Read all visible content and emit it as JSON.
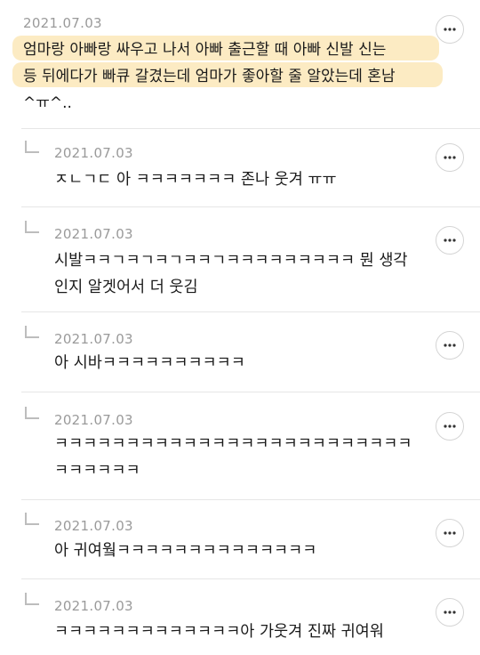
{
  "comments": [
    {
      "date": "2021.07.03",
      "text": "엄마랑 아빠랑 싸우고 나서 아빠 출근할 때 아빠 신발 신는\n등 뒤에다가 빠큐 갈겼는데 엄마가 좋아할 줄 알았는데 혼남\n^ㅠ^..",
      "more_icon": "more-horizontal-icon"
    },
    {
      "date": "2021.07.03",
      "text": "ㅈㄴㄱㄷ 아 ㅋㅋㅋㅋㅋㅋㅋ 존나 웃겨 ㅠㅠ",
      "reply_icon": "reply-arrow-icon",
      "more_icon": "more-horizontal-icon"
    },
    {
      "date": "2021.07.03",
      "text": "시발ㅋㅋㄱㅋㄱㅋㄱㅋㅋㄱㅋㅋㅋㅋㅋㅋㅋㅋㅋ 뭔 생각\n인지 알겟어서 더 웃김",
      "reply_icon": "reply-arrow-icon",
      "more_icon": "more-horizontal-icon"
    },
    {
      "date": "2021.07.03",
      "text": "아 시바ㅋㅋㅋㅋㅋㅋㅋㅋㅋㅋ",
      "reply_icon": "reply-arrow-icon",
      "more_icon": "more-horizontal-icon"
    },
    {
      "date": "2021.07.03",
      "text": "ㅋㅋㅋㅋㅋㅋㅋㅋㅋㅋㅋㅋㅋㅋㅋㅋㅋㅋㅋㅋㅋㅋㅋㅋㅋ\nㅋㅋㅋㅋㅋㅋ",
      "reply_icon": "reply-arrow-icon",
      "more_icon": "more-horizontal-icon"
    },
    {
      "date": "2021.07.03",
      "text": "아 귀여웤ㅋㅋㅋㅋㅋㅋㅋㅋㅋㅋㅋㅋㅋㅋ",
      "reply_icon": "reply-arrow-icon",
      "more_icon": "more-horizontal-icon"
    },
    {
      "date": "2021.07.03",
      "text": "ㅋㅋㅋㅋㅋㅋㅋㅋㅋㅋㅋㅋㅋ아 가웃겨 진짜 귀여워",
      "reply_icon": "reply-arrow-icon",
      "more_icon": "more-horizontal-icon"
    }
  ],
  "colors": {
    "highlight": "#fbe7b8",
    "date": "#9a9a9a",
    "text": "#1a1a1a",
    "divider": "#e6e6e6"
  }
}
